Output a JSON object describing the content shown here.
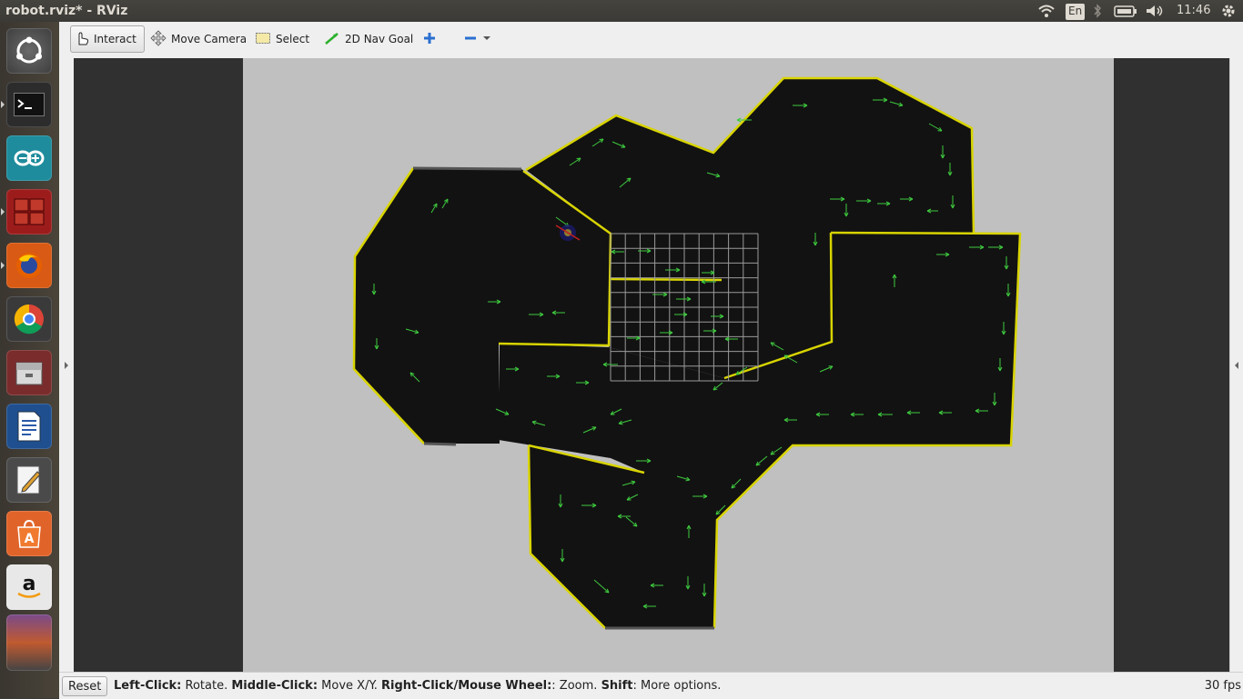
{
  "window": {
    "title": "robot.rviz* - RViz"
  },
  "tray": {
    "keyboard": "En",
    "clock": "11:46"
  },
  "launcher": {
    "items": [
      {
        "name": "ubuntu-dash-icon"
      },
      {
        "name": "terminal-icon"
      },
      {
        "name": "arduino-icon"
      },
      {
        "name": "workspaces-icon"
      },
      {
        "name": "firefox-icon"
      },
      {
        "name": "chrome-icon"
      },
      {
        "name": "file-manager-icon"
      },
      {
        "name": "writer-icon"
      },
      {
        "name": "text-editor-icon"
      },
      {
        "name": "software-center-icon"
      },
      {
        "name": "amazon-icon"
      },
      {
        "name": "stacked-apps-icon"
      }
    ]
  },
  "toolbar": {
    "interact": "Interact",
    "move_camera": "Move Camera",
    "select": "Select",
    "nav_goal": "2D Nav Goal"
  },
  "status": {
    "reset": "Reset",
    "hint_1_b": "Left-Click:",
    "hint_1": " Rotate. ",
    "hint_2_b": "Middle-Click:",
    "hint_2": " Move X/Y. ",
    "hint_3_b": "Right-Click/Mouse Wheel:",
    "hint_3": ": Zoom. ",
    "hint_4_b": "Shift",
    "hint_4": ": More options.",
    "fps": "30 fps"
  },
  "colors": {
    "map_free": "#121212",
    "map_unknown": "#c0c0c0",
    "wall": "#d8d400",
    "particles": "#3ec93e",
    "grid": "#a0a0a0"
  }
}
